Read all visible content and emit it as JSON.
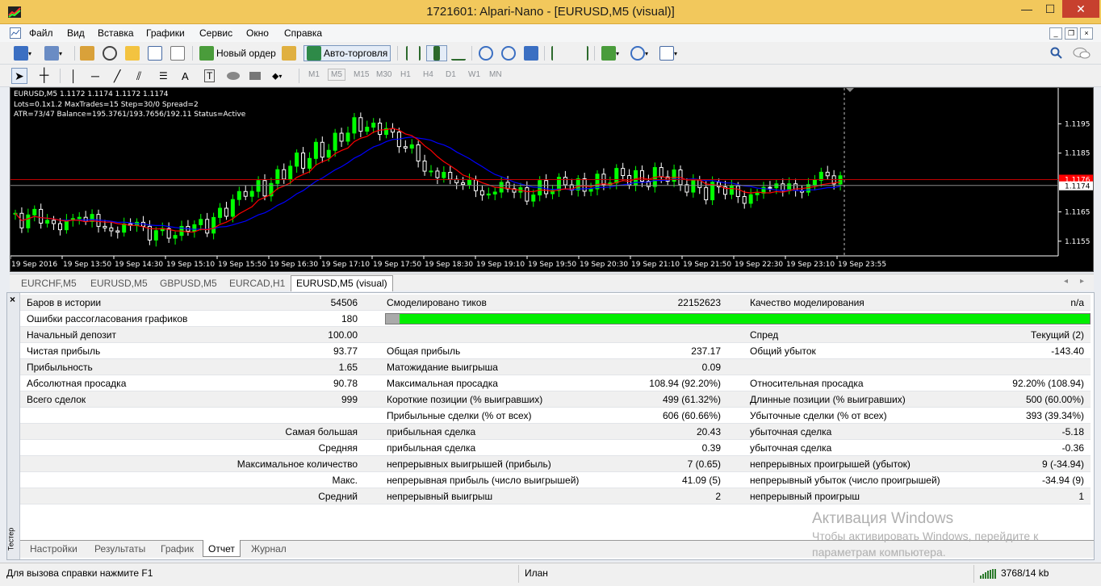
{
  "window": {
    "title": "1721601: Alpari-Nano - [EURUSD,M5 (visual)]",
    "buttons": {
      "minimize": "—",
      "maximize": "☐",
      "close": "✕"
    }
  },
  "menu": [
    "Файл",
    "Вид",
    "Вставка",
    "Графики",
    "Сервис",
    "Окно",
    "Справка"
  ],
  "toolbar": {
    "new_order": "Новый ордер",
    "auto_trading": "Авто-торговля"
  },
  "timeframes": [
    "M1",
    "M5",
    "M15",
    "M30",
    "H1",
    "H4",
    "D1",
    "W1",
    "MN"
  ],
  "timeframe_active": "M5",
  "chart": {
    "info_line1": "EURUSD,M5  1.1172 1.1174 1.1172 1.1174",
    "info_line2": "Lots=0.1x1.2 MaxTrades=15 Step=30/0 Spread=2",
    "info_line3": "ATR=73/47 Balance=195.3761/193.7656/192.11 Status=Active",
    "price_ticks": [
      "1.1195",
      "1.1185",
      "1.1165",
      "1.1155"
    ],
    "price_red_label": "1.1176",
    "price_current_label": "1.1174",
    "time_labels": [
      "19 Sep 2016",
      "19 Sep 13:50",
      "19 Sep 14:30",
      "19 Sep 15:10",
      "19 Sep 15:50",
      "19 Sep 16:30",
      "19 Sep 17:10",
      "19 Sep 17:50",
      "19 Sep 18:30",
      "19 Sep 19:10",
      "19 Sep 19:50",
      "19 Sep 20:30",
      "19 Sep 21:10",
      "19 Sep 21:50",
      "19 Sep 22:30",
      "19 Sep 23:10",
      "19 Sep 23:55"
    ],
    "colors": {
      "background": "#000000",
      "bull": "#00ff00",
      "bear": "#ffffff",
      "ma_fast": "#ff0000",
      "ma_slow": "#0000ff"
    }
  },
  "chart_tabs": [
    "EURCHF,M5",
    "EURUSD,M5",
    "GBPUSD,M5",
    "EURCAD,H1",
    "EURUSD,M5 (visual)"
  ],
  "chart_tab_active": "EURUSD,M5 (visual)",
  "report": {
    "r1": {
      "a_label": "Баров в истории",
      "a_value": "54506",
      "b_label": "Смоделировано тиков",
      "b_value": "22152623",
      "c_label": "Качество моделирования",
      "c_value": "n/a"
    },
    "r2": {
      "a_label": "Ошибки рассогласования графиков",
      "a_value": "180",
      "quality_fill": 0.98
    },
    "r3": {
      "a_label": "Начальный депозит",
      "a_value": "100.00",
      "c_label": "Спред",
      "c_value": "Текущий (2)"
    },
    "r4": {
      "a_label": "Чистая прибыль",
      "a_value": "93.77",
      "b_label": "Общая прибыль",
      "b_value": "237.17",
      "c_label": "Общий убыток",
      "c_value": "-143.40"
    },
    "r5": {
      "a_label": "Прибыльность",
      "a_value": "1.65",
      "b_label": "Матожидание выигрыша",
      "b_value": "0.09"
    },
    "r6": {
      "a_label": "Абсолютная просадка",
      "a_value": "90.78",
      "b_label": "Максимальная просадка",
      "b_value": "108.94 (92.20%)",
      "c_label": "Относительная просадка",
      "c_value": "92.20% (108.94)"
    },
    "r7": {
      "a_label": "Всего сделок",
      "a_value": "999",
      "b_label": "Короткие позиции (% выигравших)",
      "b_value": "499 (61.32%)",
      "c_label": "Длинные позиции (% выигравших)",
      "c_value": "500 (60.00%)"
    },
    "r8": {
      "b_label": "Прибыльные сделки (% от всех)",
      "b_value": "606 (60.66%)",
      "c_label": "Убыточные сделки (% от всех)",
      "c_value": "393 (39.34%)"
    },
    "r9": {
      "a_value": "Самая большая",
      "b_label": "прибыльная сделка",
      "b_value": "20.43",
      "c_label": "убыточная сделка",
      "c_value": "-5.18"
    },
    "r10": {
      "a_value": "Средняя",
      "b_label": "прибыльная сделка",
      "b_value": "0.39",
      "c_label": "убыточная сделка",
      "c_value": "-0.36"
    },
    "r11": {
      "a_value": "Максимальное количество",
      "b_label": "непрерывных выигрышей (прибыль)",
      "b_value": "7 (0.65)",
      "c_label": "непрерывных проигрышей (убыток)",
      "c_value": "9 (-34.94)"
    },
    "r12": {
      "a_value": "Макс.",
      "b_label": "непрерывная прибыль (число выигрышей)",
      "b_value": "41.09 (5)",
      "c_label": "непрерывный убыток (число проигрышей)",
      "c_value": "-34.94 (9)"
    },
    "r13": {
      "a_value": "Средний",
      "b_label": "непрерывный выигрыш",
      "b_value": "2",
      "c_label": "непрерывный проигрыш",
      "c_value": "1"
    }
  },
  "tester": {
    "close": "×",
    "side_label": "Тестер",
    "tabs": [
      "Настройки",
      "Результаты",
      "График",
      "Отчет",
      "Журнал"
    ],
    "active_tab": "Отчет"
  },
  "watermark": {
    "line1": "Активация Windows",
    "line2": "Чтобы активировать Windows, перейдите к",
    "line3": "параметрам компьютера."
  },
  "status": {
    "help": "Для вызова справки нажмите F1",
    "user": "Илан",
    "traffic": "3768/14 kb"
  }
}
